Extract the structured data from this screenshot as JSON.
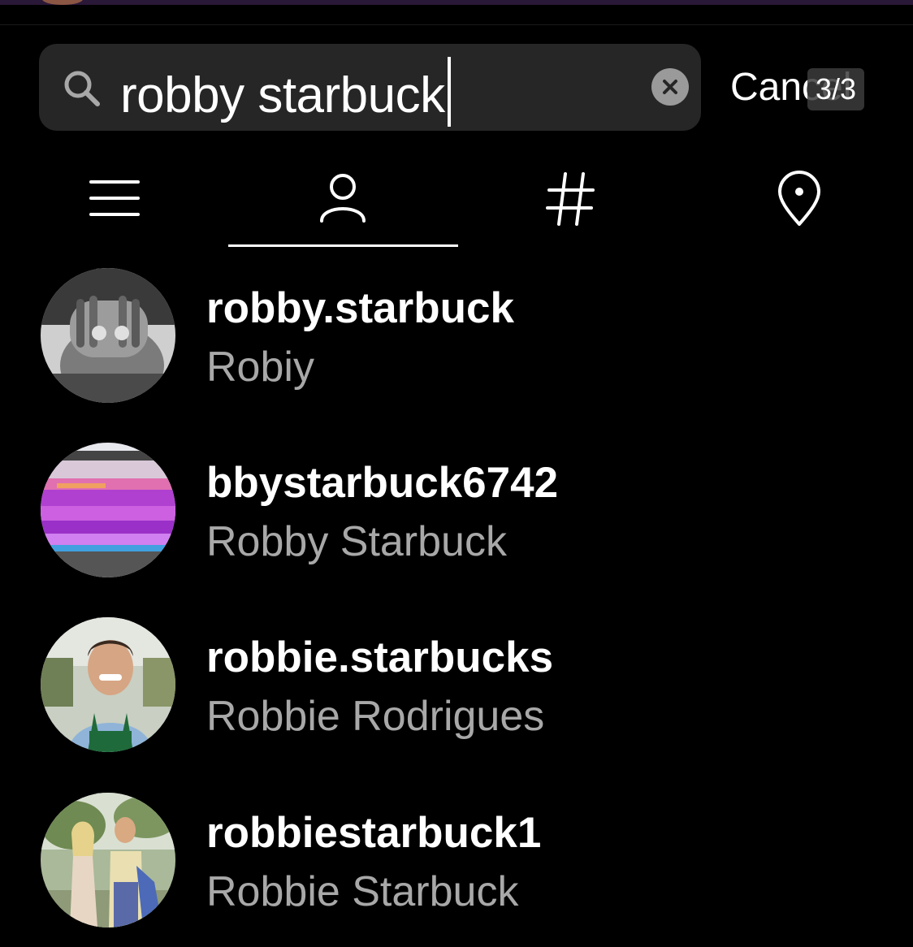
{
  "search": {
    "query": "robby starbuck",
    "cancel_label": "Cancel",
    "counter": "3/3"
  },
  "tabs": [
    {
      "name": "top",
      "icon": "list-icon",
      "selected": false
    },
    {
      "name": "accounts",
      "icon": "person-icon",
      "selected": true
    },
    {
      "name": "tags",
      "icon": "hashtag-icon",
      "selected": false
    },
    {
      "name": "places",
      "icon": "location-pin-icon",
      "selected": false
    }
  ],
  "results": [
    {
      "username": "robby.starbuck",
      "full_name": "Robiy",
      "avatar": "black-and-white-hands-over-face"
    },
    {
      "username": "bbystarbuck6742",
      "full_name": "Robby Starbuck",
      "avatar": "purple-glitch"
    },
    {
      "username": "robbie.starbucks",
      "full_name": "Robbie Rodrigues",
      "avatar": "smiling-man-green-apron"
    },
    {
      "username": "robbiestarbuck1",
      "full_name": "Robbie Starbuck",
      "avatar": "couple-outdoors"
    }
  ],
  "colors": {
    "background": "#000000",
    "search_bg": "#262626",
    "secondary_text": "#a8a8a8"
  }
}
